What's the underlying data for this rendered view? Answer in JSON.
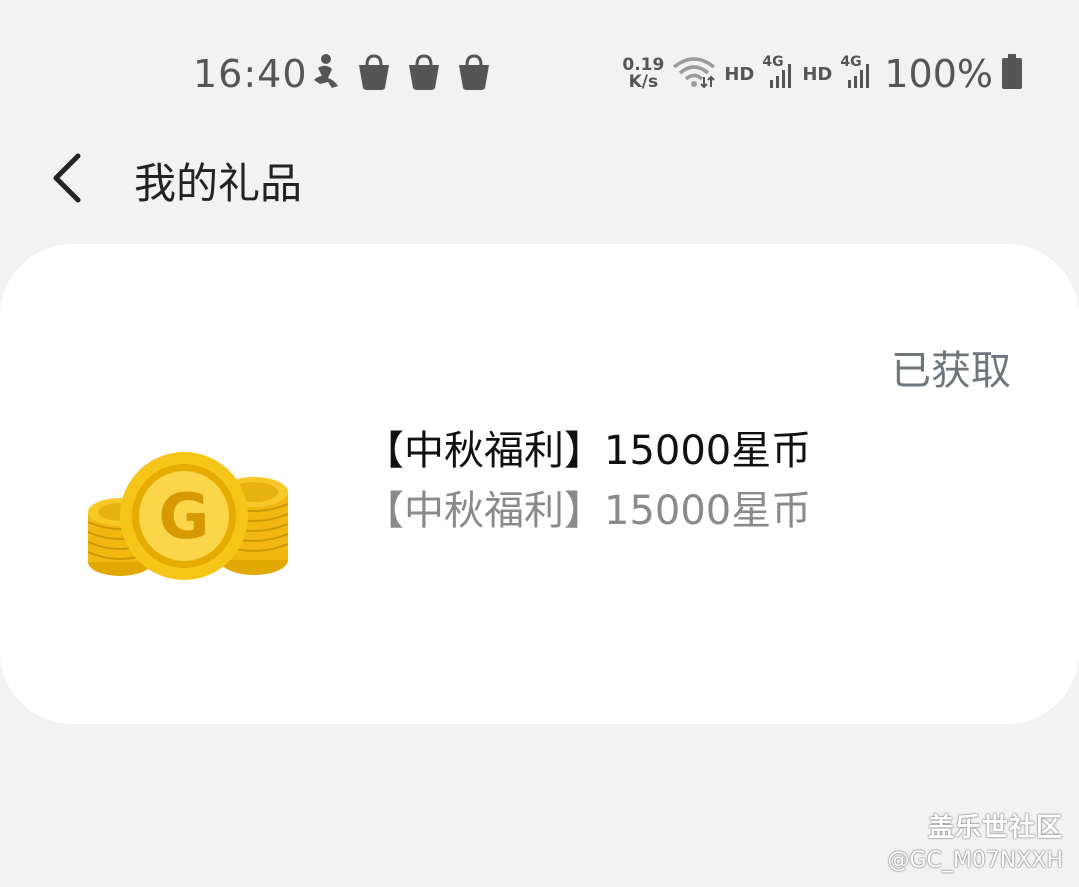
{
  "status_bar": {
    "time": "16:40",
    "left_icons": [
      "figure-icon",
      "shopping-bag-icon",
      "shopping-bag-icon",
      "shopping-bag-icon"
    ],
    "net_speed_value": "0.19",
    "net_speed_unit": "K/s",
    "sim1_hd": "HD",
    "sim1_network": "4G",
    "sim2_hd": "HD",
    "sim2_network": "4G",
    "battery": "100%"
  },
  "header": {
    "title": "我的礼品"
  },
  "gift": {
    "status": "已获取",
    "title": "【中秋福利】15000星币",
    "subtitle": "【中秋福利】15000星币",
    "icon": "gold-coins-icon",
    "coin_letter": "G"
  },
  "watermark": {
    "brand": "盖乐世社区",
    "user": "@GC_M07NXXH"
  },
  "colors": {
    "background": "#f2f2f2",
    "card": "#ffffff",
    "status_text": "#6e757c",
    "coin_gold": "#f5c518"
  }
}
